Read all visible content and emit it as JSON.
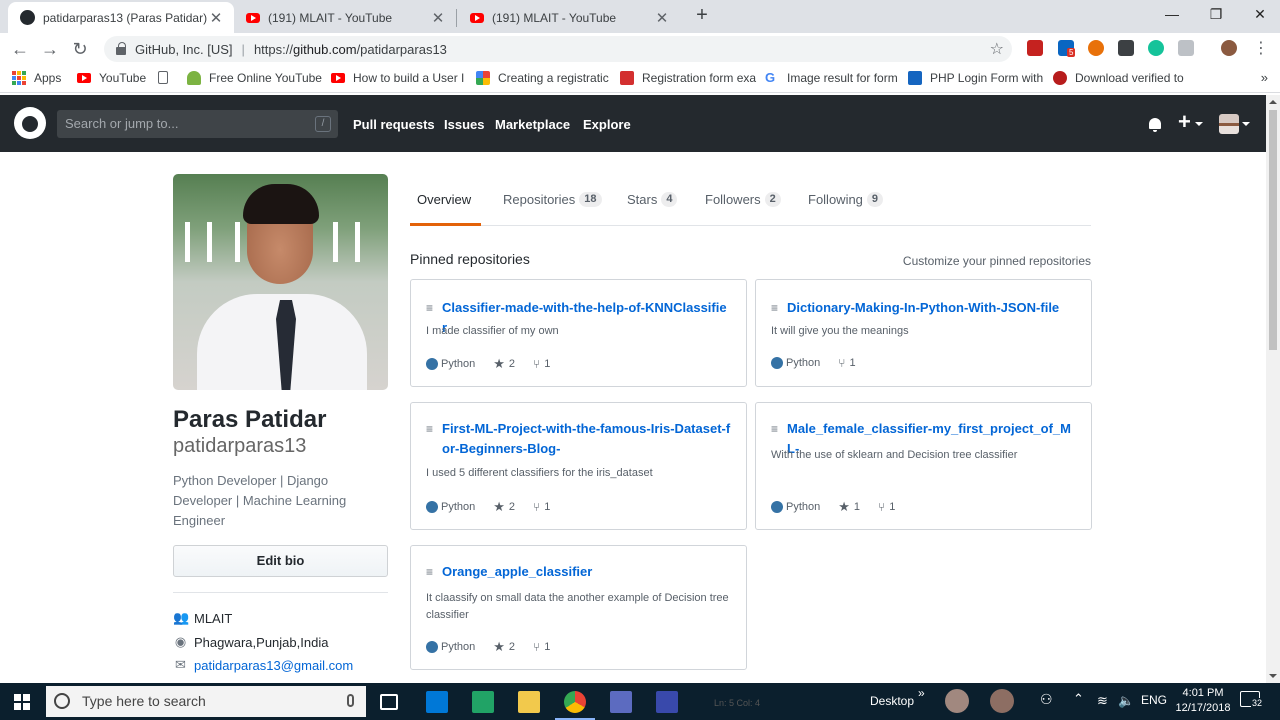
{
  "browser": {
    "tabs": [
      {
        "title": "patidarparas13 (Paras Patidar)",
        "active": true
      },
      {
        "title": "(191) MLAIT - YouTube",
        "active": false
      },
      {
        "title": "(191) MLAIT - YouTube",
        "active": false
      }
    ],
    "org": "GitHub, Inc. [US]",
    "url_prefix": "https://",
    "url_host": "github.com",
    "url_path": "/patidarparas13",
    "bookmarks": [
      {
        "label": "Apps"
      },
      {
        "label": "YouTube"
      },
      {
        "label": ""
      },
      {
        "label": "Free Online YouTube"
      },
      {
        "label": "How to build a User I"
      },
      {
        "label": "Creating a registratic"
      },
      {
        "label": "Registration form exa"
      },
      {
        "label": "Image result for form"
      },
      {
        "label": "PHP Login Form with"
      },
      {
        "label": "Download verified to"
      }
    ],
    "bookmarks_more": "»",
    "extension_badge": "5"
  },
  "github_header": {
    "search_placeholder": "Search or jump to...",
    "search_shortcut": "/",
    "nav": [
      "Pull requests",
      "Issues",
      "Marketplace",
      "Explore"
    ]
  },
  "profile": {
    "name": "Paras Patidar",
    "login": "patidarparas13",
    "bio": "Python Developer | Django Developer | Machine Learning Engineer",
    "edit_bio": "Edit bio",
    "organization": "MLAIT",
    "location": "Phagwara,Punjab,India",
    "email": "patidarparas13@gmail.com"
  },
  "tabs": [
    {
      "label": "Overview",
      "count": ""
    },
    {
      "label": "Repositories",
      "count": "18"
    },
    {
      "label": "Stars",
      "count": "4"
    },
    {
      "label": "Followers",
      "count": "2"
    },
    {
      "label": "Following",
      "count": "9"
    }
  ],
  "pinned": {
    "heading": "Pinned repositories",
    "customize": "Customize your pinned repositories",
    "repos": [
      {
        "name": "Classifier-made-with-the-help-of-KNNClassifier",
        "description": "I made classifier of my own",
        "language": "Python",
        "stars": "2",
        "forks": "1"
      },
      {
        "name": "Dictionary-Making-In-Python-With-JSON-file",
        "description": "It will give you the meanings",
        "language": "Python",
        "stars": "",
        "forks": "1"
      },
      {
        "name": "First-ML-Project-with-the-famous-Iris-Dataset-for-Beginners-Blog-",
        "description": "I used 5 different classifiers for the iris_dataset",
        "language": "Python",
        "stars": "2",
        "forks": "1"
      },
      {
        "name": "Male_female_classifier-my_first_project_of_ML-",
        "description": "With the use of sklearn and Decision tree classifier",
        "language": "Python",
        "stars": "1",
        "forks": "1"
      },
      {
        "name": "Orange_apple_classifier",
        "description": "It claassify on small data the another example of Decision tree classifier",
        "language": "Python",
        "stars": "2",
        "forks": "1"
      }
    ],
    "language_color": "#3572A5"
  },
  "taskbar": {
    "search_placeholder": "Type here to search",
    "desktop_label": "Desktop",
    "desktop_more": "»",
    "language": "ENG",
    "time": "4:01 PM",
    "date": "12/17/2018",
    "notifications": "32",
    "background_text": "Ln: 5   Col: 4"
  }
}
